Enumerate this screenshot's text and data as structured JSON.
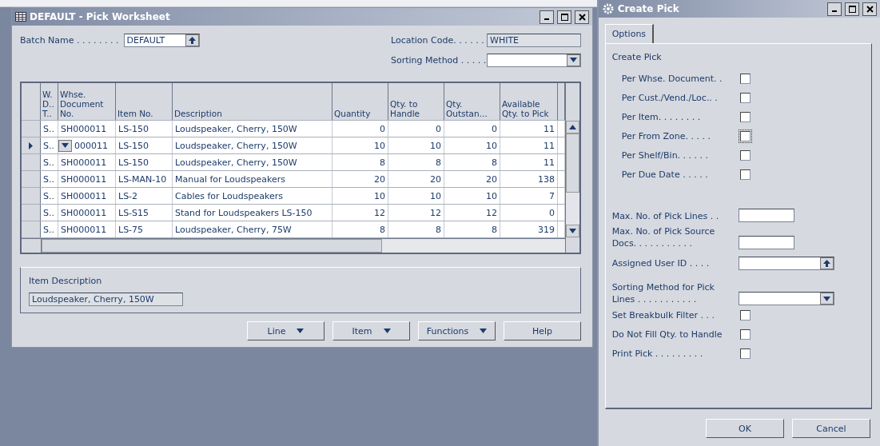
{
  "worksheet": {
    "title": "DEFAULT - Pick Worksheet",
    "batch_name": {
      "label": "Batch Name . . . . . . . .",
      "value": "DEFAULT"
    },
    "location_code": {
      "label": "Location Code. . . . . .",
      "value": "WHITE"
    },
    "sorting_method": {
      "label": "Sorting Method . . . . ."
    },
    "table": {
      "columns": [
        "W. D.. T..",
        "Whse. Document No.",
        "Item No.",
        "Description",
        "Quantity",
        "Qty. to Handle",
        "Qty. Outstan...",
        "Available Qty. to Pick"
      ],
      "rows": [
        {
          "selected": false,
          "editing": false,
          "cells": [
            "S..",
            "SH000011",
            "LS-150",
            "Loudspeaker, Cherry, 150W",
            "0",
            "0",
            "0",
            "11"
          ]
        },
        {
          "selected": true,
          "editing": true,
          "cells": [
            "S..",
            "000011",
            "LS-150",
            "Loudspeaker, Cherry, 150W",
            "10",
            "10",
            "10",
            "11"
          ]
        },
        {
          "selected": false,
          "editing": false,
          "cells": [
            "S..",
            "SH000011",
            "LS-150",
            "Loudspeaker, Cherry, 150W",
            "8",
            "8",
            "8",
            "11"
          ]
        },
        {
          "selected": false,
          "editing": false,
          "cells": [
            "S..",
            "SH000011",
            "LS-MAN-10",
            "Manual for Loudspeakers",
            "20",
            "20",
            "20",
            "138"
          ]
        },
        {
          "selected": false,
          "editing": false,
          "cells": [
            "S..",
            "SH000011",
            "LS-2",
            "Cables for Loudspeakers",
            "10",
            "10",
            "10",
            "7"
          ]
        },
        {
          "selected": false,
          "editing": false,
          "cells": [
            "S..",
            "SH000011",
            "LS-S15",
            "Stand for Loudspeakers LS-150",
            "12",
            "12",
            "12",
            "0"
          ]
        },
        {
          "selected": false,
          "editing": false,
          "cells": [
            "S..",
            "SH000011",
            "LS-75",
            "Loudspeaker, Cherry, 75W",
            "8",
            "8",
            "8",
            "319"
          ]
        }
      ]
    },
    "item_description": {
      "label": "Item Description",
      "value": "Loudspeaker, Cherry, 150W"
    },
    "buttons": [
      {
        "label": "Line",
        "kind": "menu"
      },
      {
        "label": "Item",
        "kind": "menu"
      },
      {
        "label": "Functions",
        "kind": "menu"
      },
      {
        "label": "Help",
        "kind": "plain"
      }
    ]
  },
  "dialog": {
    "title": "Create Pick",
    "tabs": [
      {
        "label": "Options",
        "selected": true
      }
    ],
    "group_label": "Create Pick",
    "options": [
      {
        "kind": "check",
        "label": "Per Whse. Document. .",
        "checked": false,
        "focused": false,
        "indent": true
      },
      {
        "kind": "check",
        "label": "Per Cust./Vend./Loc.. .",
        "checked": false,
        "focused": false,
        "indent": true
      },
      {
        "kind": "check",
        "label": "Per Item. . . . . . . .",
        "checked": false,
        "focused": false,
        "indent": true
      },
      {
        "kind": "check",
        "label": "Per From Zone. . . . .",
        "checked": false,
        "focused": true,
        "indent": true
      },
      {
        "kind": "check",
        "label": "Per Shelf/Bin. . . . . .",
        "checked": false,
        "focused": false,
        "indent": true
      },
      {
        "kind": "check",
        "label": "Per Due Date . . . . .",
        "checked": false,
        "focused": false,
        "indent": true
      },
      {
        "kind": "gap"
      },
      {
        "kind": "text",
        "label": "Max. No. of Pick Lines . ."
      },
      {
        "kind": "text",
        "label": "Max. No. of Pick Source Docs. . . . . . . . . . ."
      },
      {
        "kind": "lookup",
        "label": "Assigned User ID . . . ."
      },
      {
        "kind": "select",
        "label": "Sorting Method for Pick Lines . . . . . . . . . . ."
      },
      {
        "kind": "check",
        "label": "Set Breakbulk Filter . . .",
        "checked": false,
        "focused": false,
        "indent": false
      },
      {
        "kind": "check",
        "label": "Do Not Fill Qty. to Handle",
        "checked": false,
        "focused": false,
        "indent": false
      },
      {
        "kind": "check",
        "label": "Print Pick . . . . . . . . .",
        "checked": false,
        "focused": false,
        "indent": false
      }
    ],
    "buttons": [
      "OK",
      "Cancel"
    ]
  }
}
